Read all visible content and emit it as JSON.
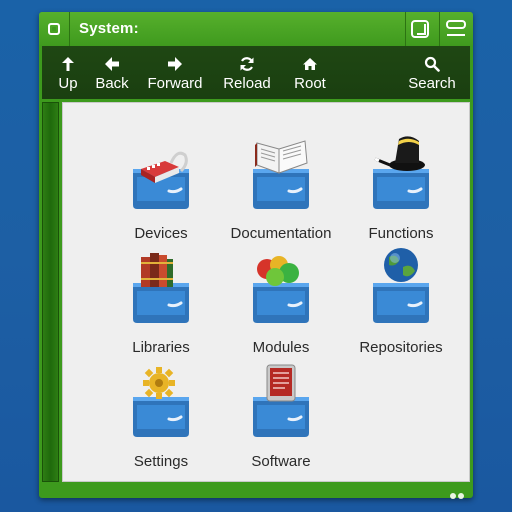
{
  "window": {
    "title": "System:"
  },
  "toolbar": {
    "items": [
      {
        "label": "Up",
        "icon": "arrow-up-icon"
      },
      {
        "label": "Back",
        "icon": "arrow-left-icon"
      },
      {
        "label": "Forward",
        "icon": "arrow-right-icon"
      },
      {
        "label": "Reload",
        "icon": "reload-icon"
      },
      {
        "label": "Root",
        "icon": "home-icon"
      },
      {
        "label": "Search",
        "icon": "search-icon"
      }
    ]
  },
  "drawers": [
    {
      "label": "Devices",
      "icon": "devices-drawer-icon"
    },
    {
      "label": "Documentation",
      "icon": "documentation-drawer-icon"
    },
    {
      "label": "Functions",
      "icon": "functions-drawer-icon"
    },
    {
      "label": "Libraries",
      "icon": "libraries-drawer-icon"
    },
    {
      "label": "Modules",
      "icon": "modules-drawer-icon"
    },
    {
      "label": "Repositories",
      "icon": "repositories-drawer-icon"
    },
    {
      "label": "Settings",
      "icon": "settings-drawer-icon"
    },
    {
      "label": "Software",
      "icon": "software-drawer-icon"
    }
  ],
  "colors": {
    "desktop": "#1a62a8",
    "window_frame": "#3d9a1d",
    "toolbar": "#1f4713",
    "content_bg": "#efefef",
    "drawer_blue": "#3a8ad6"
  }
}
